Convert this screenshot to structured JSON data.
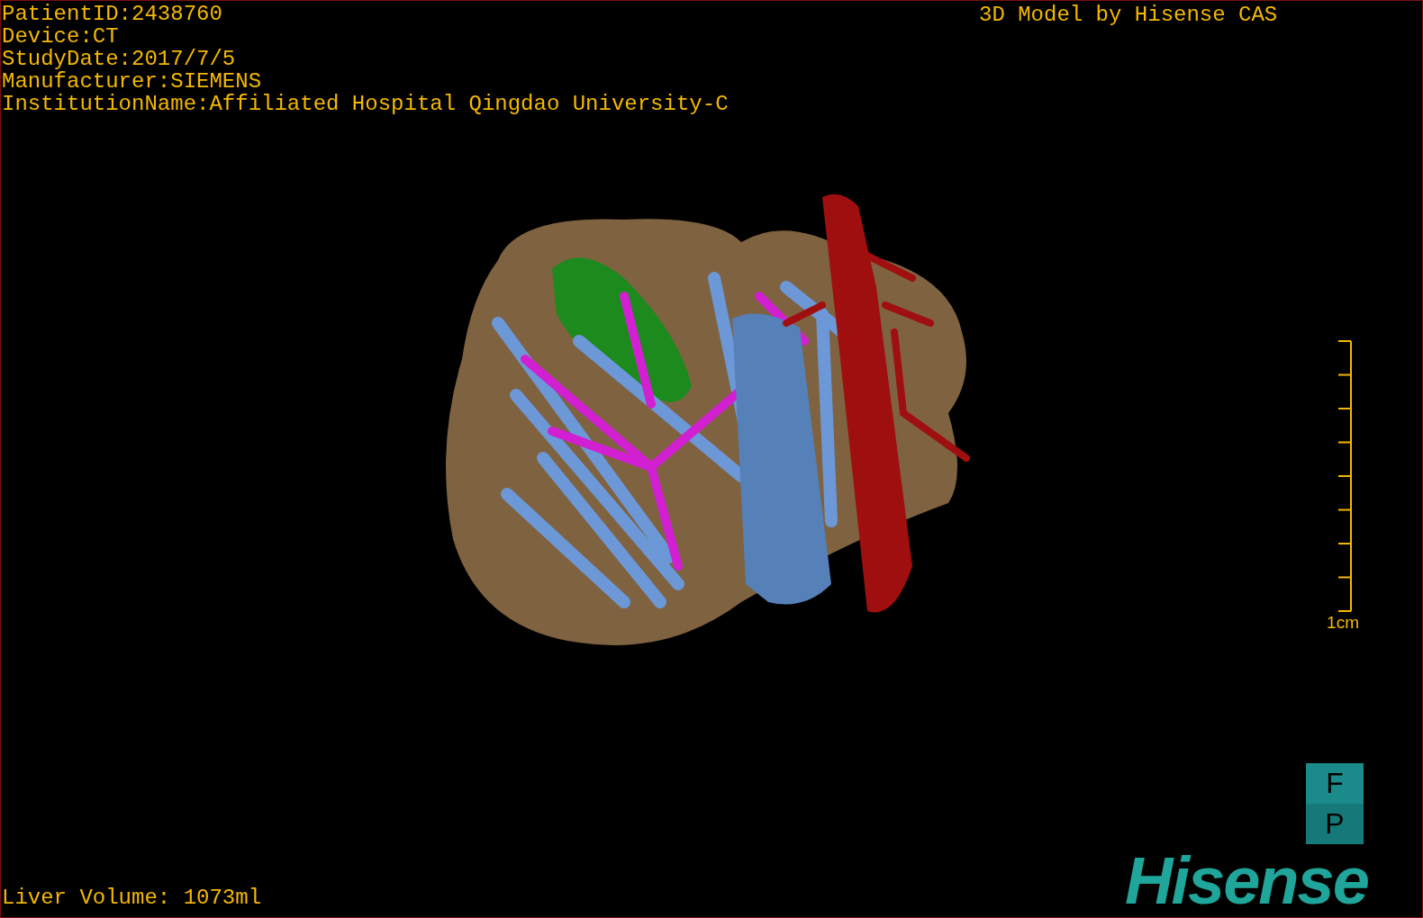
{
  "patient_info": [
    "PatientID:2438760",
    "Device:CT",
    "StudyDate:2017/7/5",
    "Manufacturer:SIEMENS",
    "InstitutionName:Affiliated Hospital Qingdao University-C"
  ],
  "caption": "3D Model by Hisense CAS",
  "scale_bar": {
    "label": "1cm"
  },
  "orientation": {
    "top": "F",
    "bottom": "P"
  },
  "logo": "Hisense",
  "liver_volume": "Liver Volume: 1073ml"
}
